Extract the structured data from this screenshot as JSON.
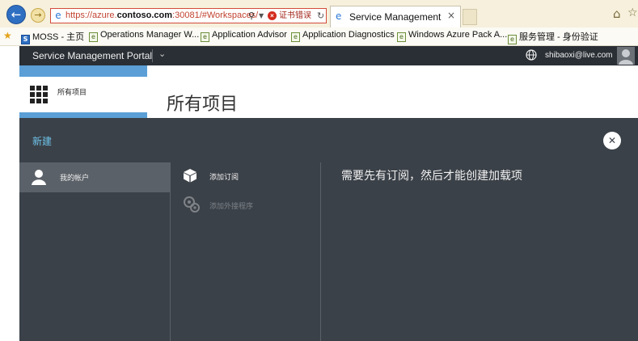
{
  "browser": {
    "url_prefix": "https://azure.",
    "url_domain": "contoso.com",
    "url_suffix": ":30081/#Workspaces/",
    "cert_error": "证书错误",
    "tab_title": "Service Management",
    "tab_close": "×"
  },
  "favorites": [
    {
      "icon": "sharepoint-icon",
      "label": "MOSS - 主页"
    },
    {
      "icon": "ie-page-icon",
      "label": "Operations Manager W..."
    },
    {
      "icon": "ie-page-icon",
      "label": "Application Advisor"
    },
    {
      "icon": "ie-page-icon",
      "label": "Application Diagnostics"
    },
    {
      "icon": "ie-page-icon",
      "label": "Windows Azure Pack A..."
    },
    {
      "icon": "ie-page-icon",
      "label": "服务管理 - 身份验证"
    }
  ],
  "portal": {
    "title": "Service Management Portal",
    "user_email": "shibaoxi@live.com",
    "nav_item_label": "所有项目",
    "page_title": "所有项目"
  },
  "overlay": {
    "new_label": "新建",
    "account_label": "我的帐户",
    "add_subscription_label": "添加订阅",
    "add_extension_label": "添加外接程序",
    "message": "需要先有订阅，然后才能创建加载项"
  },
  "colors": {
    "accent_blue": "#5b9fd6",
    "overlay_bg": "#3b4148",
    "header_bg": "#2a2f35",
    "new_label_color": "#6ec3ea"
  }
}
